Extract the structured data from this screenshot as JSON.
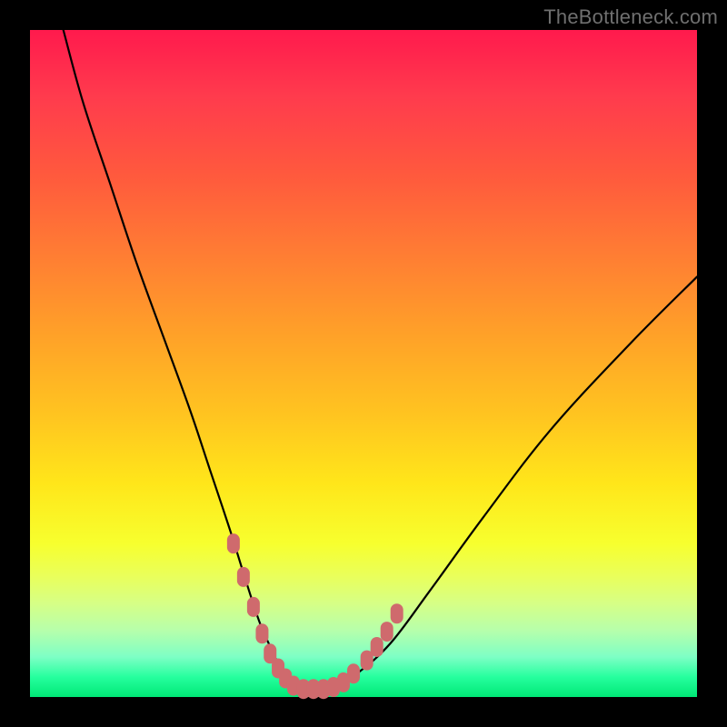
{
  "watermark": {
    "text": "TheBottleneck.com"
  },
  "colors": {
    "background": "#000000",
    "curve_stroke": "#000000",
    "marker_fill": "#cf6a6d",
    "marker_stroke": "#cf6a6d"
  },
  "chart_data": {
    "type": "line",
    "title": "",
    "xlabel": "",
    "ylabel": "",
    "xlim": [
      0,
      100
    ],
    "ylim": [
      0,
      100
    ],
    "grid": false,
    "legend": false,
    "series": [
      {
        "name": "curve",
        "x": [
          5,
          8,
          12,
          16,
          20,
          24,
          27,
          30,
          32.5,
          34.5,
          36.5,
          38,
          39.5,
          41,
          44,
          46,
          49,
          54,
          60,
          68,
          78,
          90,
          100
        ],
        "y": [
          100,
          89,
          77,
          65,
          54,
          43,
          34,
          25,
          17,
          11,
          6.5,
          3.2,
          1.5,
          1.2,
          1.2,
          1.7,
          3.5,
          8,
          16,
          27,
          40,
          53,
          63
        ]
      }
    ],
    "markers": [
      {
        "x": 30.5,
        "y": 23
      },
      {
        "x": 32.0,
        "y": 18
      },
      {
        "x": 33.5,
        "y": 13.5
      },
      {
        "x": 34.8,
        "y": 9.5
      },
      {
        "x": 36.0,
        "y": 6.5
      },
      {
        "x": 37.2,
        "y": 4.3
      },
      {
        "x": 38.3,
        "y": 2.8
      },
      {
        "x": 39.5,
        "y": 1.7
      },
      {
        "x": 41.0,
        "y": 1.2
      },
      {
        "x": 42.5,
        "y": 1.2
      },
      {
        "x": 44.0,
        "y": 1.2
      },
      {
        "x": 45.5,
        "y": 1.5
      },
      {
        "x": 47.0,
        "y": 2.2
      },
      {
        "x": 48.5,
        "y": 3.5
      },
      {
        "x": 50.5,
        "y": 5.5
      },
      {
        "x": 52.0,
        "y": 7.5
      },
      {
        "x": 53.5,
        "y": 9.8
      },
      {
        "x": 55.0,
        "y": 12.5
      }
    ]
  }
}
